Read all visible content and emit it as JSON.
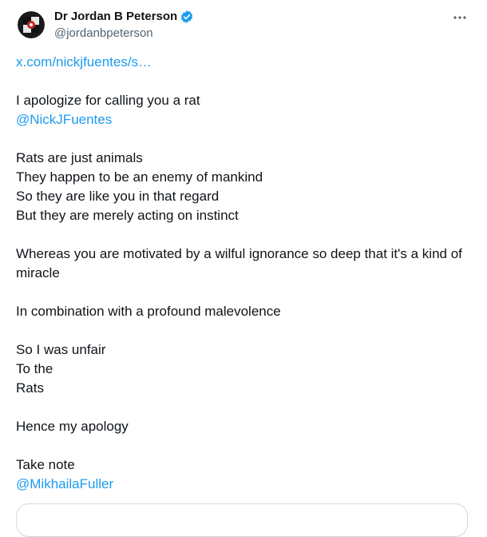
{
  "author": {
    "display_name": "Dr Jordan B Peterson",
    "handle": "@jordanbpeterson",
    "verified_icon": "verified-badge-icon",
    "verified_color": "#1d9bf0"
  },
  "menu": {
    "icon": "more-horizontal-icon"
  },
  "post": {
    "link_url": "x.com/nickjfuentes/s…",
    "l1": "I apologize for calling you a rat",
    "mention1": "@NickJFuentes",
    "l2": "Rats are just animals",
    "l3": "They happen to be an enemy of mankind",
    "l4": "So they are like you in that regard",
    "l5": "But they are merely acting on instinct",
    "l6": "Whereas you are motivated by a wilful ignorance so deep that it's a kind of miracle",
    "l7": "In combination with a profound malevolence",
    "l8": "So I was unfair",
    "l9": "To the",
    "l10": "Rats",
    "l11": "Hence my apology",
    "l12": "Take note",
    "mention2": "@MikhailaFuller"
  },
  "colors": {
    "link": "#1d9bf0",
    "text": "#0f1419",
    "secondary": "#536471"
  }
}
